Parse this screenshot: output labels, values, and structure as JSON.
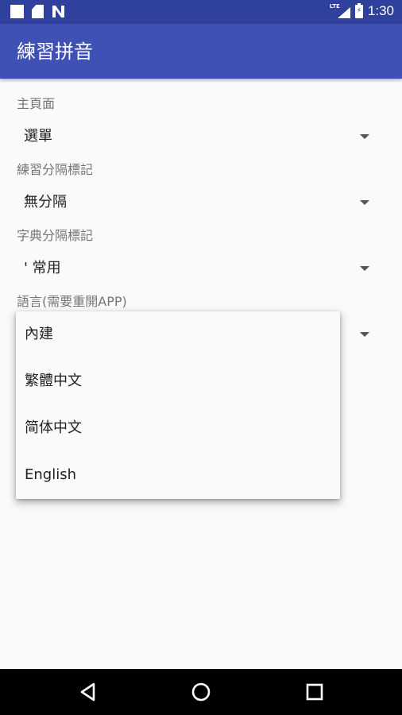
{
  "status_bar": {
    "time": "1:30",
    "network": "LTE",
    "icons": [
      "notification-square-icon",
      "sd-card-icon",
      "n-app-icon",
      "signal-icon",
      "battery-charging-icon"
    ],
    "color": "#30409d"
  },
  "app_bar": {
    "title": "練習拼音",
    "color": "#3f51b5"
  },
  "settings": [
    {
      "label": "主頁面",
      "value": "選單"
    },
    {
      "label": "練習分隔標記",
      "value": "無分隔"
    },
    {
      "label": "字典分隔標記",
      "value": "' 常用"
    },
    {
      "label": "語言(需要重開APP)",
      "value": ""
    }
  ],
  "language_dropdown": {
    "options": [
      "內建",
      "繁體中文",
      "简体中文",
      "English"
    ]
  },
  "nav_bar": {
    "buttons": [
      "back-icon",
      "home-icon",
      "recents-icon"
    ]
  }
}
